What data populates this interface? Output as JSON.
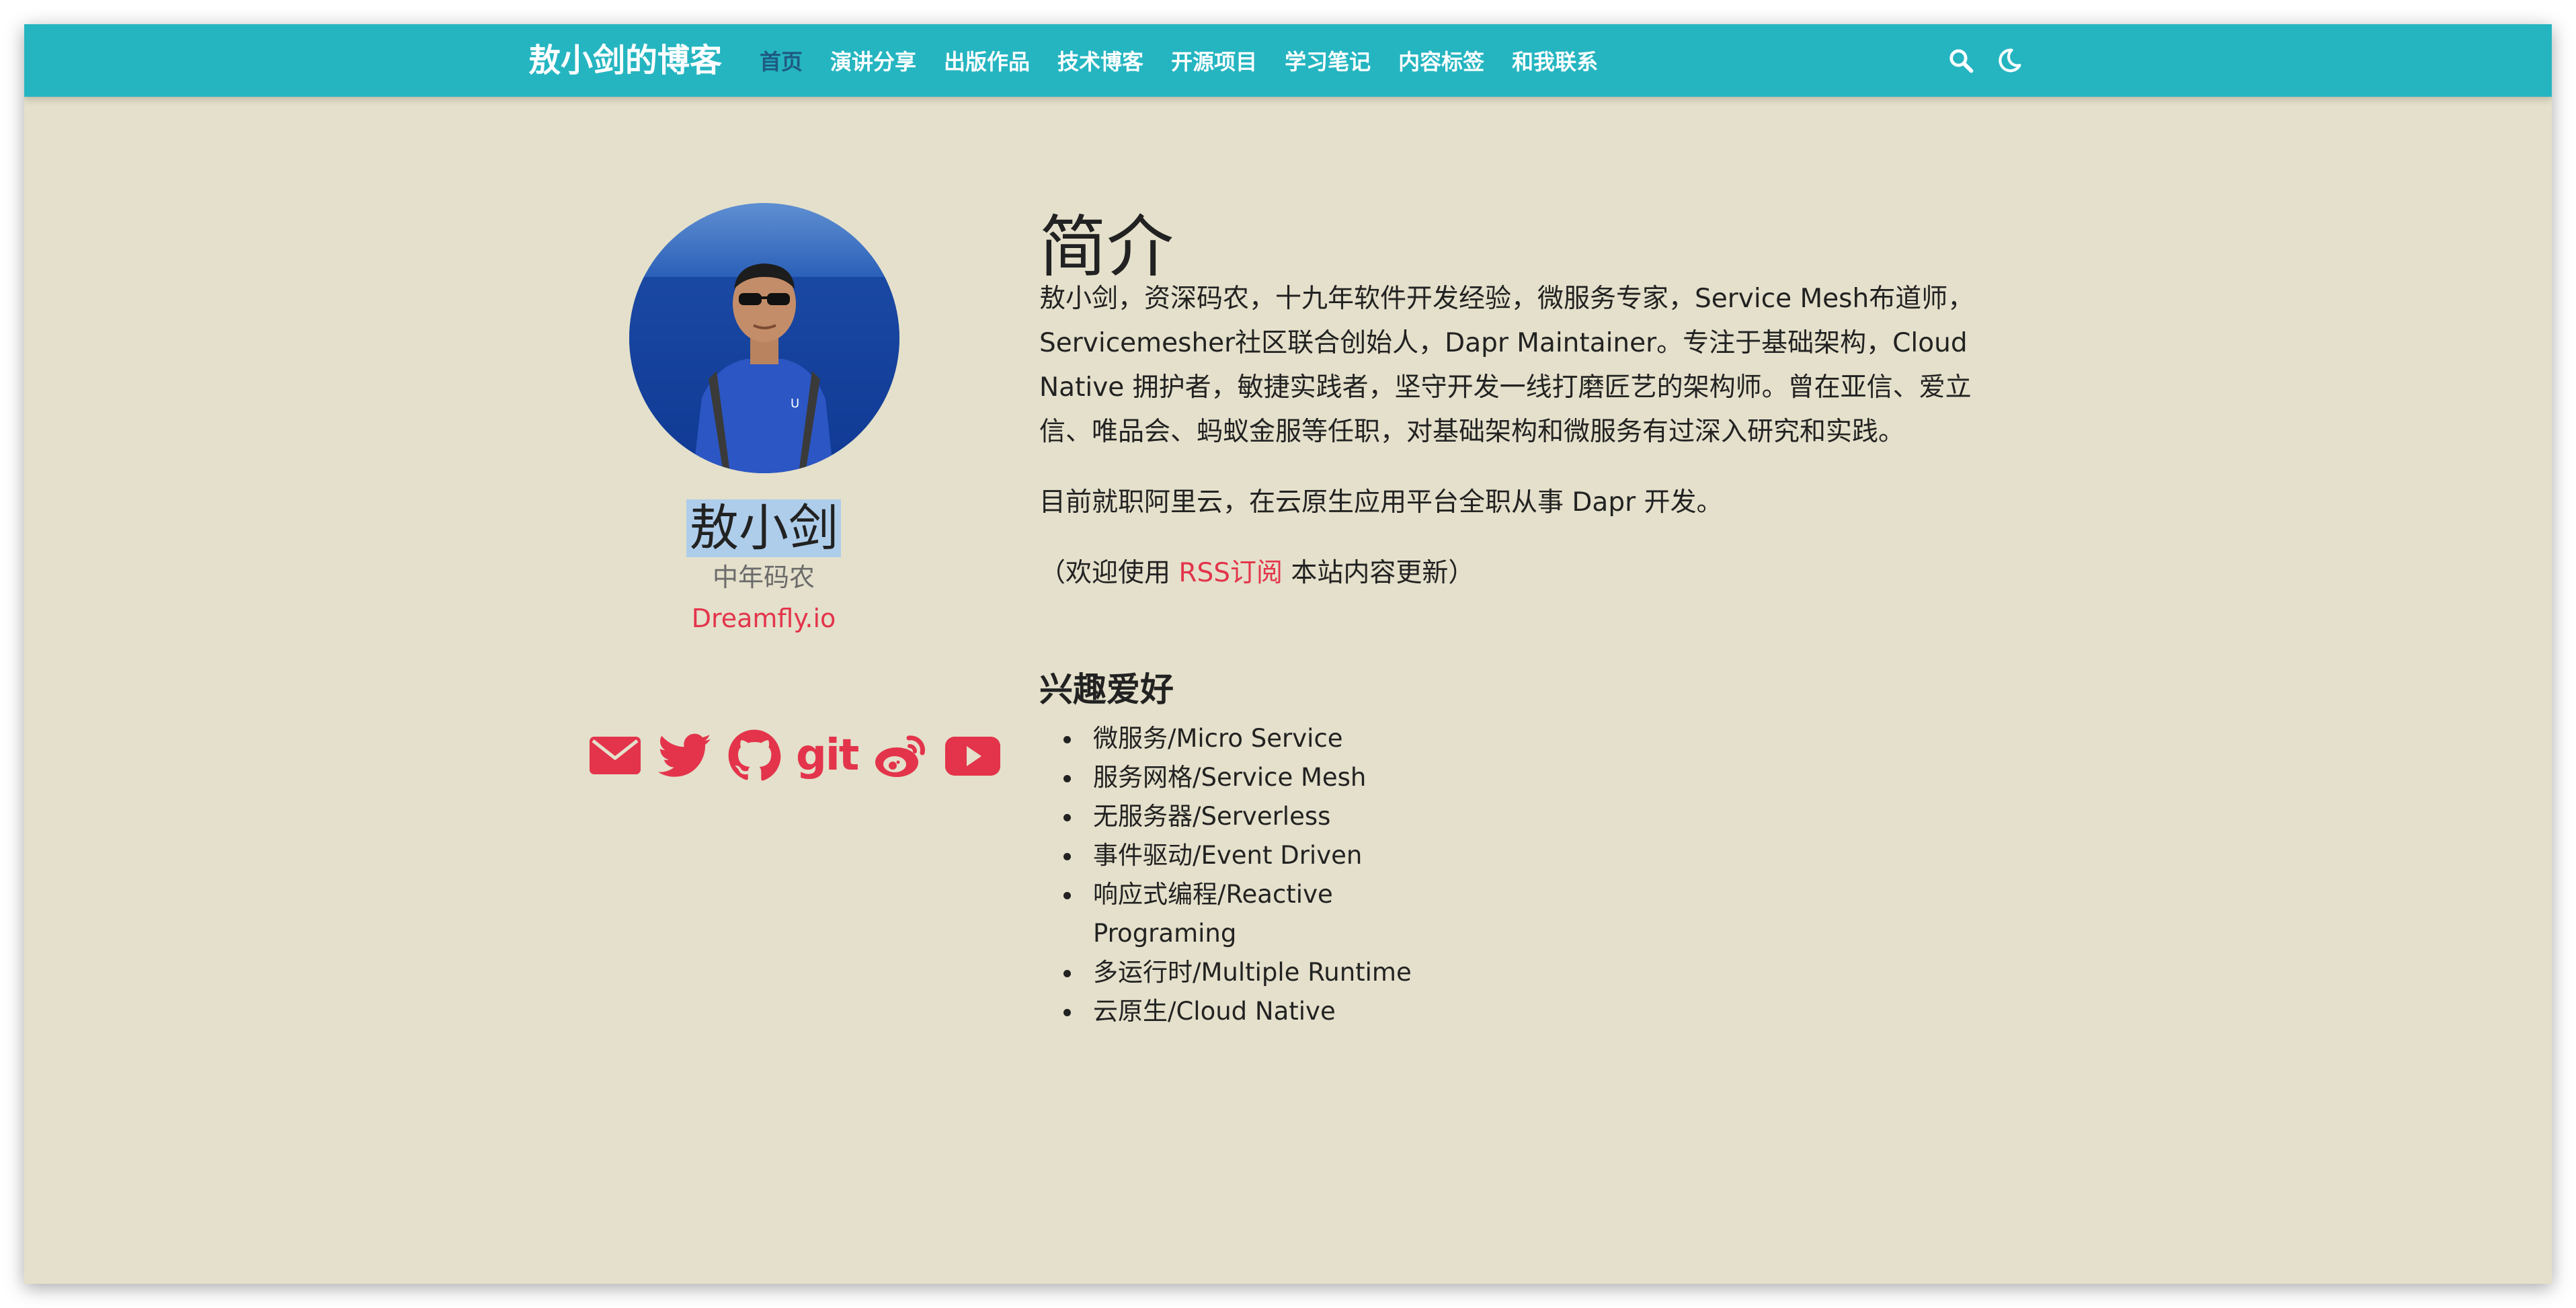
{
  "navbar": {
    "brand": "敖小剑的博客",
    "items": [
      {
        "label": "首页",
        "active": true
      },
      {
        "label": "演讲分享"
      },
      {
        "label": "出版作品"
      },
      {
        "label": "技术博客"
      },
      {
        "label": "开源项目"
      },
      {
        "label": "学习笔记"
      },
      {
        "label": "内容标签"
      },
      {
        "label": "和我联系"
      }
    ],
    "icons": [
      "search-icon",
      "moon-icon"
    ]
  },
  "profile": {
    "name": "敖小剑",
    "tagline": "中年码农",
    "site": "Dreamfly.io",
    "social": [
      "email-icon",
      "twitter-icon",
      "github-icon",
      "git-icon",
      "weibo-icon",
      "youtube-icon"
    ],
    "git_label": "git"
  },
  "intro": {
    "title": "简介",
    "p1": "敖小剑，资深码农，十九年软件开发经验，微服务专家，Service Mesh布道师，Servicemesher社区联合创始人，Dapr Maintainer。专注于基础架构，Cloud Native 拥护者，敏捷实践者，坚守开发一线打磨匠艺的架构师。曾在亚信、爱立信、唯品会、蚂蚁金服等任职，对基础架构和微服务有过深入研究和实践。",
    "p2": "目前就职阿里云，在云原生应用平台全职从事 Dapr 开发。",
    "p3_before": "（欢迎使用 ",
    "p3_link": "RSS订阅",
    "p3_after": " 本站内容更新）"
  },
  "interests": {
    "title": "兴趣爱好",
    "items": [
      "微服务/Micro Service",
      "服务网格/Service Mesh",
      "无服务器/Serverless",
      "事件驱动/Event Driven",
      "响应式编程/Reactive Programing",
      "多运行时/Multiple Runtime",
      "云原生/Cloud Native"
    ]
  },
  "colors": {
    "navbar": "#25b5c1",
    "background": "#e4e0cb",
    "accent": "#e3344b",
    "active_nav": "#1e5a83",
    "selection": "#aecdeb"
  }
}
